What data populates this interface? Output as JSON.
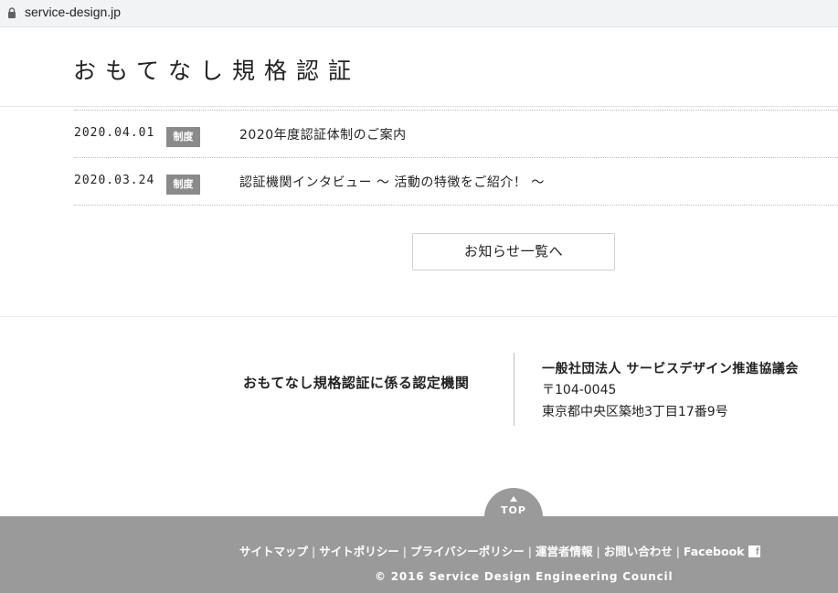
{
  "browser": {
    "url": "service-design.jp"
  },
  "header": {
    "site_title": "おもてなし規格認証"
  },
  "news": {
    "items": [
      {
        "date": "2020.04.01",
        "category": "制度",
        "title": "2020年度認証体制のご案内"
      },
      {
        "date": "2020.03.24",
        "category": "制度",
        "title": "認証機関インタビュー 〜 活動の特徴をご紹介！ 〜"
      }
    ],
    "more_label": "お知らせ一覧へ"
  },
  "org": {
    "tagline": "おもてなし規格認証に係る認定機関",
    "name": "一般社団法人 サービスデザイン推進協議会",
    "zip": "〒104-0045",
    "address": "東京都中央区築地3丁目17番9号"
  },
  "footer": {
    "top_label": "TOP",
    "links": [
      "サイトマップ",
      "サイトポリシー",
      "プライバシーポリシー",
      "運営者情報",
      "お問い合わせ",
      "Facebook"
    ],
    "separator": "|",
    "copyright": "© 2016 Service Design Engineering Council"
  },
  "icons": {
    "lock": "lock-icon",
    "facebook": "facebook-icon",
    "top_arrow": "arrow-up-icon"
  },
  "colors": {
    "badge": "#8a8a8a",
    "footer": "#9a9a9a"
  }
}
